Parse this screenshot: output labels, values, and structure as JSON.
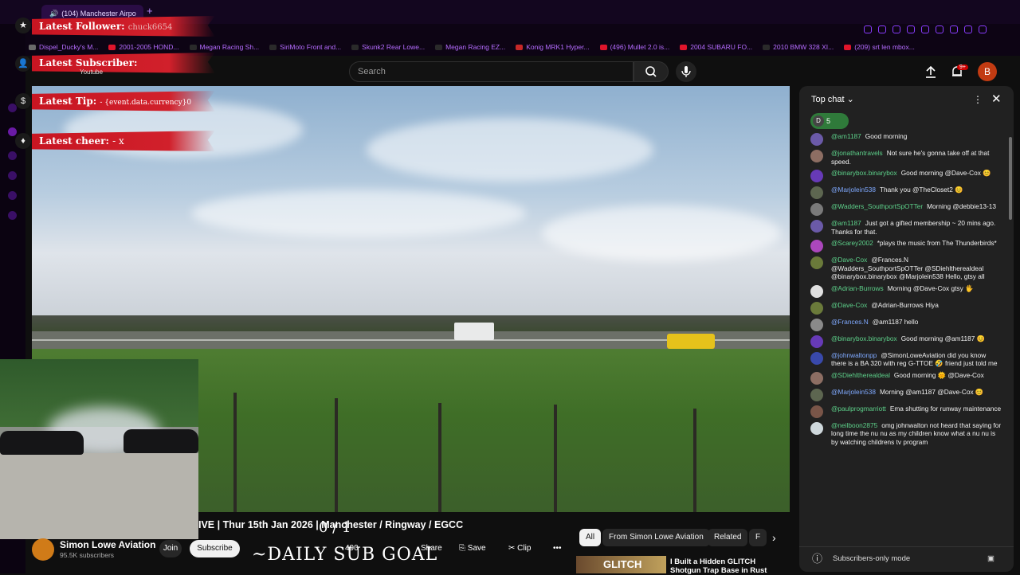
{
  "browser": {
    "tab_title": "(104) Manchester Airpo",
    "bookmarks": [
      "Dispel_Ducky's M...",
      "2001-2005 HOND...",
      "Megan Racing Sh...",
      "SiriMoto Front and...",
      "Skunk2 Rear Lowe...",
      "Megan Racing EZ...",
      "Konig MRK1 Hyper...",
      "(496) Mullet 2.0 is...",
      "2004 SUBARU FO...",
      "2010 BMW 328 XI...",
      "(209) srt len mbox..."
    ]
  },
  "youtube": {
    "search_placeholder": "Search",
    "notif_count": "9+",
    "avatar_letter": "B"
  },
  "overlay": {
    "latest_follower": "Latest Follower:",
    "follower_name": "chuck6654",
    "latest_subscriber": "Latest Subscriber:",
    "subscriber_name": "Youtube",
    "latest_tip": "Latest Tip:",
    "tip_value": "- {event.data.currency}0",
    "latest_cheer": "Latest cheer:",
    "cheer_value": "- x",
    "daily_sub_goal": "~DAILY SUB GOAL",
    "goal_count": "0 / 1"
  },
  "video": {
    "title": "IVE | Thur 15th Jan 2026 | Manchester / Ringway / EGCC",
    "channel": "Simon Lowe Aviation",
    "subscribers": "95.5K subscribers",
    "join": "Join",
    "subscribe": "Subscribe",
    "likes": "490",
    "share": "Share",
    "save": "Save",
    "clip": "Clip"
  },
  "related": {
    "chips": [
      "All",
      "From Simon Lowe Aviation",
      "Related",
      "F"
    ],
    "first_title": "I Built a Hidden GLITCH",
    "first_title2": "Shotgun Trap Base in Rust",
    "thumb_text": "GLITCH"
  },
  "chat": {
    "header": "Top chat",
    "pill_count": "5",
    "footer": "Subscribers-only mode",
    "messages": [
      {
        "author": "@am1187",
        "text": "Good morning",
        "color": "#6b5aa8",
        "mod": false
      },
      {
        "author": "@jonathantravels",
        "text": "Not sure he's gonna take off at that speed.",
        "color": "#8d6e63",
        "mod": false
      },
      {
        "author": "@binarybox.binarybox",
        "text": "Good morning @Dave-Cox 😊",
        "color": "#673ab7",
        "mod": false
      },
      {
        "author": "@Marjolein538",
        "text": "Thank you @TheCloset2 😊",
        "color": "#5d6650",
        "mod": true
      },
      {
        "author": "@Wadders_SouthportSpOTTer",
        "text": "Morning @debbie13-13",
        "color": "#7a7a7a",
        "mod": false
      },
      {
        "author": "@am1187",
        "text": "Just got a gifted membership ~ 20 mins ago. Thanks for that.",
        "color": "#6b5aa8",
        "mod": false
      },
      {
        "author": "@Scarey2002",
        "text": "*plays the music from The Thunderbirds*",
        "color": "#ab47bc",
        "mod": false
      },
      {
        "author": "@Dave-Cox",
        "text": "@Frances.N @Wadders_SouthportSpOTTer @SDiehltherealdeal @binarybox.binarybox @Marjolein538 Hello, gtsy all",
        "color": "#6a7a3a",
        "mod": false
      },
      {
        "author": "@Adrian-Burrows",
        "text": "Morning @Dave-Cox gtsy 🖐",
        "color": "#e0e0e0",
        "mod": false
      },
      {
        "author": "@Dave-Cox",
        "text": "@Adrian-Burrows Hiya",
        "color": "#6a7a3a",
        "mod": false
      },
      {
        "author": "@Frances.N",
        "text": "@am1187 hello",
        "color": "#8a8a8a",
        "mod": true
      },
      {
        "author": "@binarybox.binarybox",
        "text": "Good morning @am1187 😊",
        "color": "#673ab7",
        "mod": false
      },
      {
        "author": "@johnwaltonpp",
        "text": "@SimonLoweAviation did you know there is a BA 320 with reg G-TTOE 🤣 friend just told me",
        "color": "#3949ab",
        "mod": true
      },
      {
        "author": "@SDiehltherealdeal",
        "text": "Good morning 🌞 @Dave-Cox",
        "color": "#8d6e63",
        "mod": false
      },
      {
        "author": "@Marjolein538",
        "text": "Morning @am1187 @Dave-Cox 😊",
        "color": "#5d6650",
        "mod": true
      },
      {
        "author": "@paulprogmarriott",
        "text": "Ema shutting for runway maintenance",
        "color": "#795548",
        "mod": false
      },
      {
        "author": "@neilboon2875",
        "text": "omg johnwalton not heard that saying for long time the nu nu as my children know what a nu nu is by watching childrens tv program",
        "color": "#cfd8dc",
        "mod": false
      }
    ]
  }
}
